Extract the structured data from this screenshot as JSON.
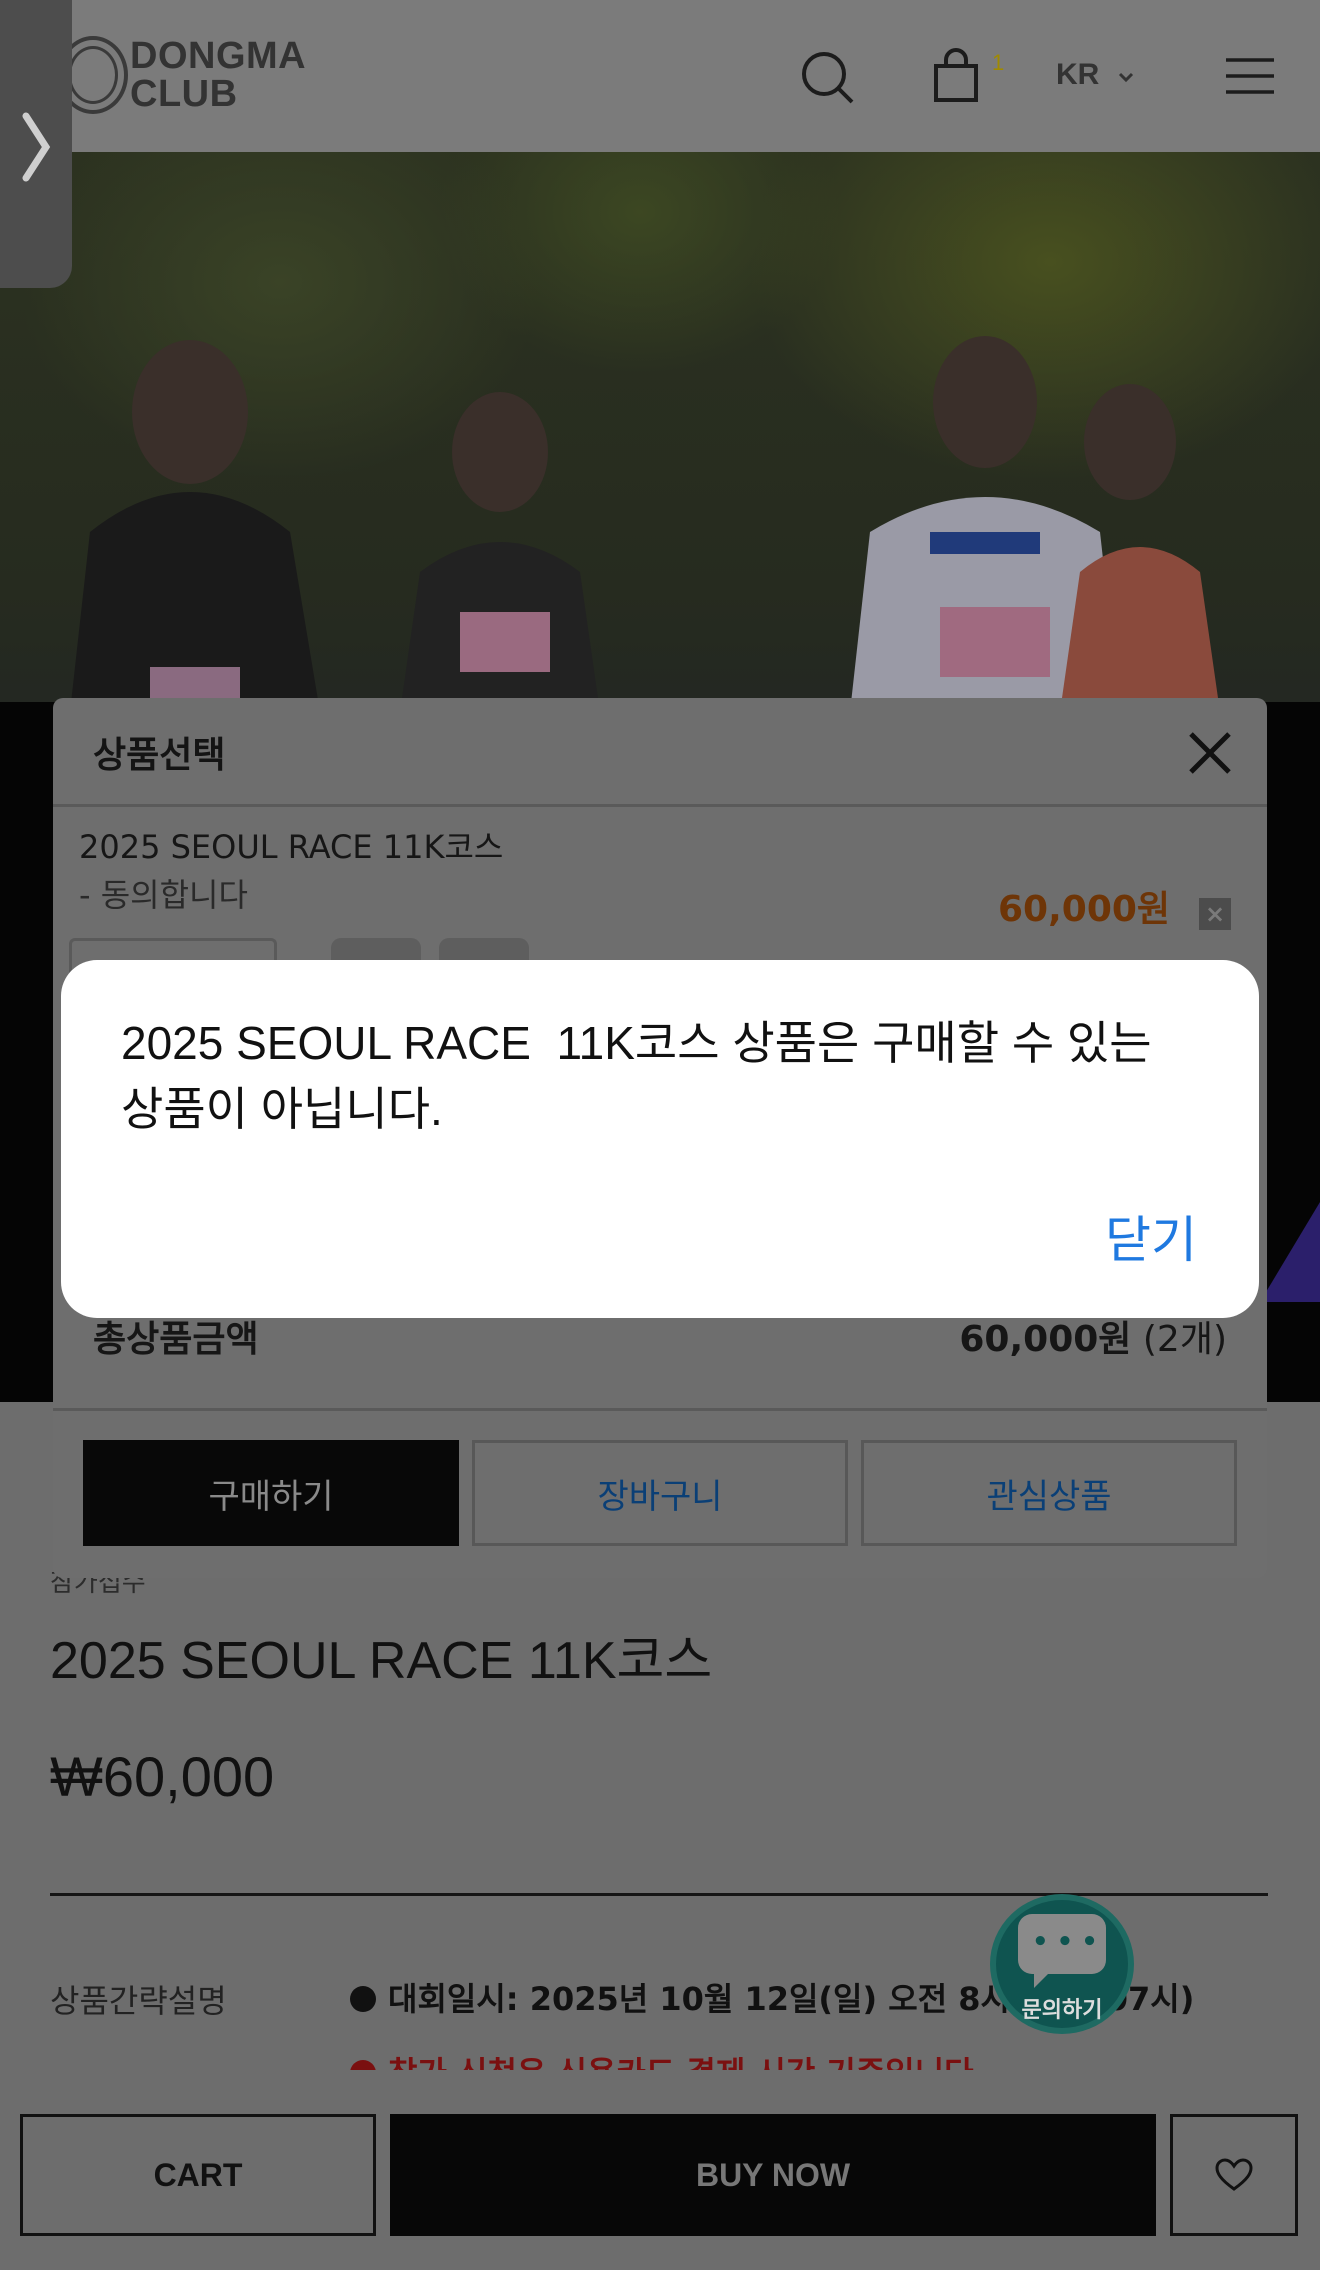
{
  "header": {
    "logo_line1": "DONGMA",
    "logo_line2": "CLUB",
    "cart_count": "1",
    "language": "KR"
  },
  "product": {
    "category": "참가접수",
    "title": "2025 SEOUL RACE 11K코스",
    "price": "₩60,000",
    "summary_label": "상품간략설명",
    "summary_line1": "대회일시: 2025년 10월 12일(일) 오전 8시 (집결 07시)",
    "summary_line2": "참가 신청은 신용카드 결제 시간 기준입니다"
  },
  "chat": {
    "label": "문의하기"
  },
  "bottom_bar": {
    "cart_label": "CART",
    "buy_label": "BUY NOW"
  },
  "panel": {
    "title": "상품선택",
    "option_name": "2025 SEOUL RACE 11K코스",
    "option_agree": "- 동의합니다",
    "option_price": "60,000원",
    "total_label": "총상품금액",
    "total_price": "60,000원",
    "total_count": "(2개)",
    "buy_button": "구매하기",
    "cart_button": "장바구니",
    "wish_button": "관심상품"
  },
  "alert": {
    "message": "2025 SEOUL RACE  11K코스 상품은 구매할 수 있는\n상품이 아닙니다.",
    "close_button": "닫기"
  },
  "colors": {
    "accent_blue": "#1f79e0",
    "price_orange": "#6e3507",
    "chat_teal": "#0f5450"
  }
}
